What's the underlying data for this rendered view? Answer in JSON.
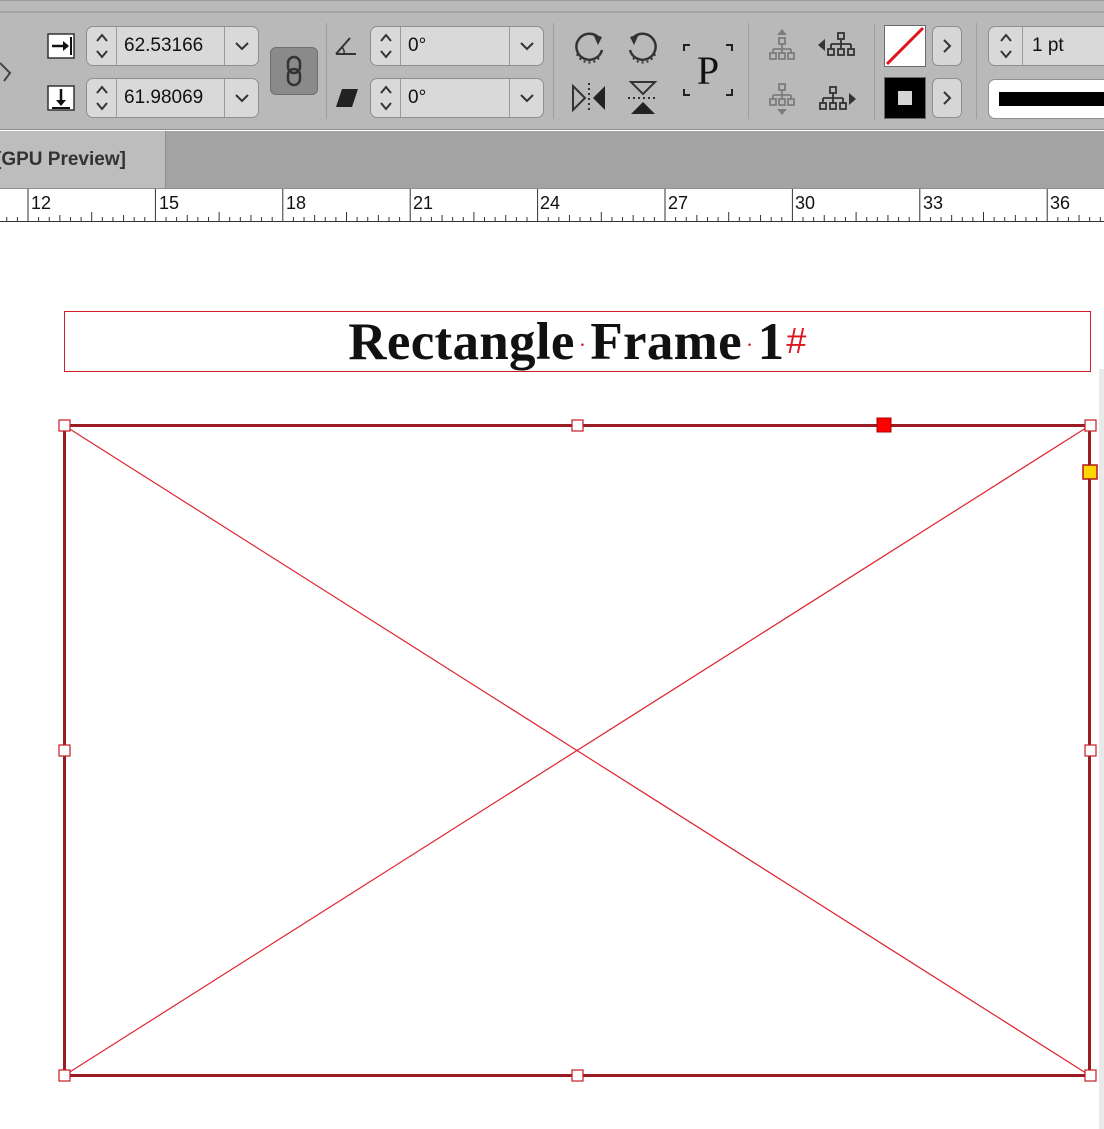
{
  "toolbar": {
    "scale_x": {
      "value": "62.53166",
      "icon": "scale-horizontal-icon"
    },
    "scale_y": {
      "value": "61.98069",
      "icon": "scale-vertical-icon"
    },
    "constrain_icon": "link-icon",
    "rotation": {
      "value": "0°",
      "icon": "rotation-angle-icon"
    },
    "shear": {
      "value": "0°",
      "icon": "shear-icon"
    },
    "transform_icons": [
      "rotate-clockwise-icon",
      "rotate-counterclockwise-icon",
      "flip-horizontal-icon",
      "flip-vertical-icon"
    ],
    "reference_point_label": "P",
    "select_icons": [
      "select-container-icon",
      "select-previous-icon",
      "select-content-icon",
      "select-next-icon"
    ],
    "fill_swatch": "none-swatch",
    "stroke_swatch": "black-stroke-swatch",
    "stroke_weight": "1 pt",
    "colors": {
      "toolbar_bg": "#b9b9b9",
      "frame_red": "#d11f2a",
      "selected_handle": "#ff0000",
      "corner_handle": "#ffd700"
    }
  },
  "document_tab": {
    "label": "[GPU Preview]"
  },
  "ruler": {
    "labels": [
      "12",
      "15",
      "18",
      "21",
      "24",
      "27",
      "30",
      "33",
      "36"
    ]
  },
  "canvas": {
    "title_frame": {
      "word1": "Rectangle",
      "word2": "Frame",
      "word3": "1",
      "end_marker": "#"
    },
    "placeholder_frame": {
      "type": "empty graphics frame"
    }
  }
}
